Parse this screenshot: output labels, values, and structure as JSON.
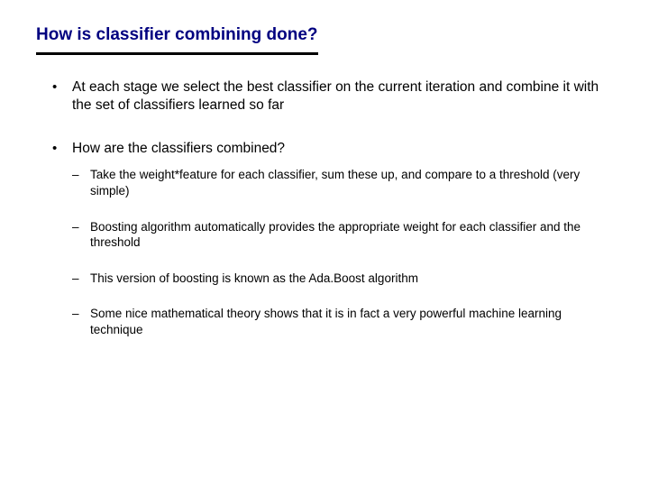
{
  "title": "How is classifier combining done?",
  "bullets": [
    {
      "text": "At each stage we select the best classifier on the current iteration and combine it with the set of classifiers learned so far"
    },
    {
      "text": "How are the classifiers combined?",
      "sub": [
        "Take the weight*feature for each classifier, sum these up, and compare to a threshold (very simple)",
        "Boosting algorithm automatically provides the appropriate weight for each classifier and the threshold",
        "This version of boosting is known as the Ada.Boost algorithm",
        "Some nice mathematical theory shows that it is in fact a very powerful machine learning technique"
      ]
    }
  ]
}
